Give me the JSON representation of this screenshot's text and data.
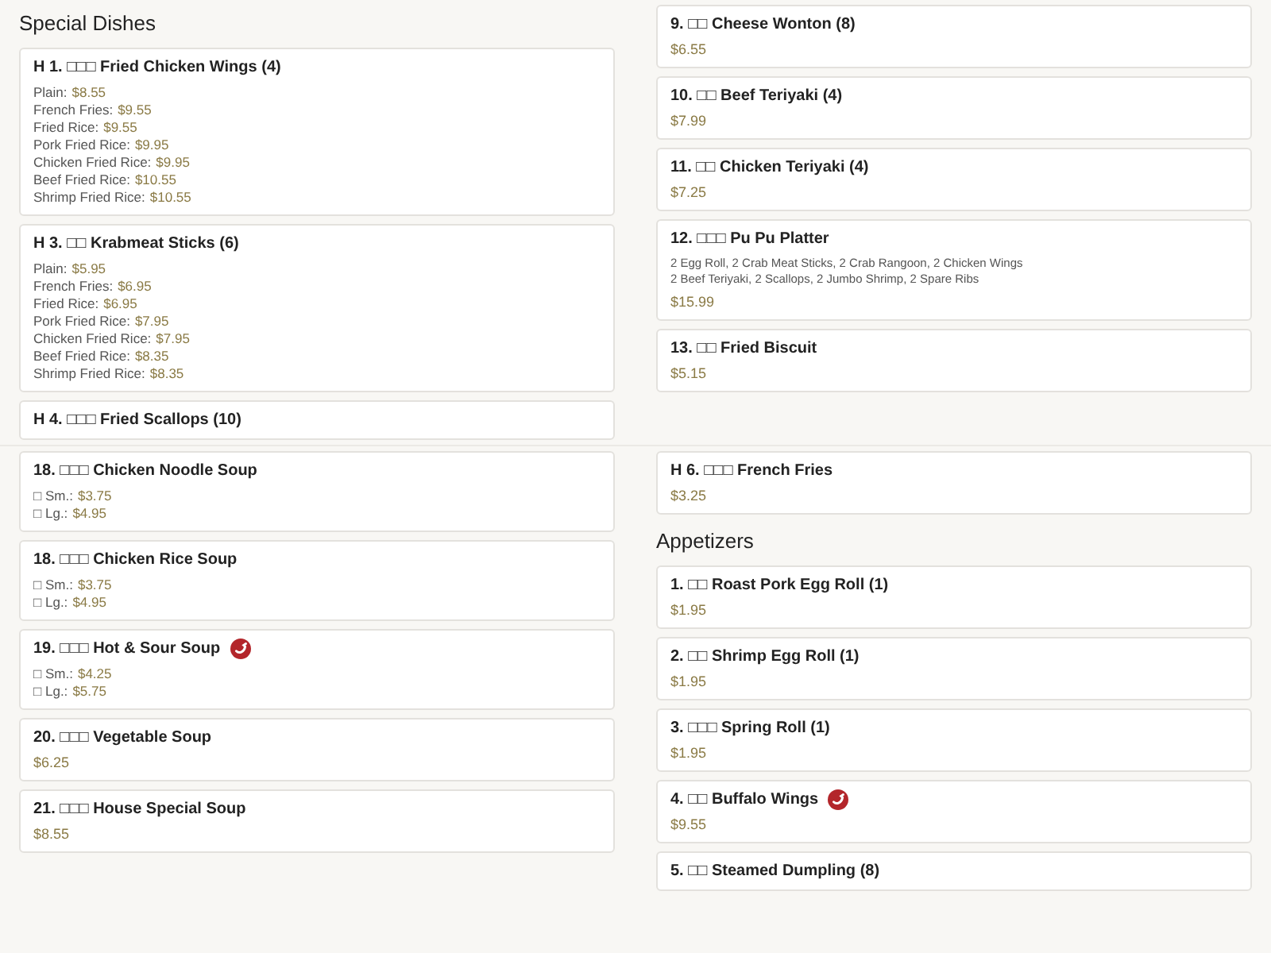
{
  "panels": [
    {
      "columns": [
        [
          {
            "kind": "heading",
            "text": "Special Dishes"
          },
          {
            "kind": "dish",
            "title": "H 1. □□□ Fried Chicken Wings (4)",
            "spicy": false,
            "options": [
              {
                "label": "Plain:",
                "price": "$8.55"
              },
              {
                "label": "French Fries:",
                "price": "$9.55"
              },
              {
                "label": "Fried Rice:",
                "price": "$9.55"
              },
              {
                "label": "Pork Fried Rice:",
                "price": "$9.95"
              },
              {
                "label": "Chicken Fried Rice:",
                "price": "$9.95"
              },
              {
                "label": "Beef Fried Rice:",
                "price": "$10.55"
              },
              {
                "label": "Shrimp Fried Rice:",
                "price": "$10.55"
              }
            ]
          },
          {
            "kind": "dish",
            "title": "H 3. □□ Krabmeat Sticks (6)",
            "spicy": false,
            "options": [
              {
                "label": "Plain:",
                "price": "$5.95"
              },
              {
                "label": "French Fries:",
                "price": "$6.95"
              },
              {
                "label": "Fried Rice:",
                "price": "$6.95"
              },
              {
                "label": "Pork Fried Rice:",
                "price": "$7.95"
              },
              {
                "label": "Chicken Fried Rice:",
                "price": "$7.95"
              },
              {
                "label": "Beef Fried Rice:",
                "price": "$8.35"
              },
              {
                "label": "Shrimp Fried Rice:",
                "price": "$8.35"
              }
            ]
          },
          {
            "kind": "dish",
            "title": "H 4. □□□ Fried Scallops (10)",
            "spicy": false
          }
        ],
        [
          {
            "kind": "dish",
            "title": "9. □□ Cheese Wonton (8)",
            "spicy": false,
            "price": "$6.55"
          },
          {
            "kind": "dish",
            "title": "10. □□ Beef Teriyaki (4)",
            "spicy": false,
            "price": "$7.99"
          },
          {
            "kind": "dish",
            "title": "11. □□ Chicken Teriyaki (4)",
            "spicy": false,
            "price": "$7.25"
          },
          {
            "kind": "dish",
            "title": "12. □□□ Pu Pu Platter",
            "spicy": false,
            "description": [
              "2 Egg Roll, 2 Crab Meat Sticks, 2 Crab Rangoon, 2 Chicken Wings",
              "2 Beef Teriyaki, 2 Scallops, 2 Jumbo Shrimp, 2 Spare Ribs"
            ],
            "price": "$15.99"
          },
          {
            "kind": "dish",
            "title": "13. □□ Fried Biscuit",
            "spicy": false,
            "price": "$5.15"
          }
        ]
      ]
    },
    {
      "columns": [
        [
          {
            "kind": "dish",
            "title": "18. □□□ Chicken Noodle Soup",
            "spicy": false,
            "options": [
              {
                "label": "□ Sm.:",
                "price": "$3.75"
              },
              {
                "label": "□ Lg.:",
                "price": "$4.95"
              }
            ]
          },
          {
            "kind": "dish",
            "title": "18. □□□ Chicken Rice Soup",
            "spicy": false,
            "options": [
              {
                "label": "□ Sm.:",
                "price": "$3.75"
              },
              {
                "label": "□ Lg.:",
                "price": "$4.95"
              }
            ]
          },
          {
            "kind": "dish",
            "title": "19. □□□ Hot & Sour Soup",
            "spicy": true,
            "options": [
              {
                "label": "□ Sm.:",
                "price": "$4.25"
              },
              {
                "label": "□ Lg.:",
                "price": "$5.75"
              }
            ]
          },
          {
            "kind": "dish",
            "title": "20. □□□ Vegetable Soup",
            "spicy": false,
            "price": "$6.25"
          },
          {
            "kind": "dish",
            "title": "21. □□□ House Special Soup",
            "spicy": false,
            "price": "$8.55"
          }
        ],
        [
          {
            "kind": "dish",
            "title": "H 6. □□□ French Fries",
            "spicy": false,
            "price": "$3.25"
          },
          {
            "kind": "heading",
            "text": "Appetizers"
          },
          {
            "kind": "dish",
            "title": "1. □□ Roast Pork Egg Roll (1)",
            "spicy": false,
            "price": "$1.95"
          },
          {
            "kind": "dish",
            "title": "2. □□ Shrimp Egg Roll (1)",
            "spicy": false,
            "price": "$1.95"
          },
          {
            "kind": "dish",
            "title": "3. □□□ Spring Roll (1)",
            "spicy": false,
            "price": "$1.95"
          },
          {
            "kind": "dish",
            "title": "4. □□ Buffalo Wings",
            "spicy": true,
            "price": "$9.55"
          },
          {
            "kind": "dish",
            "title": "5. □□ Steamed Dumpling (8)",
            "spicy": false
          }
        ]
      ]
    }
  ]
}
